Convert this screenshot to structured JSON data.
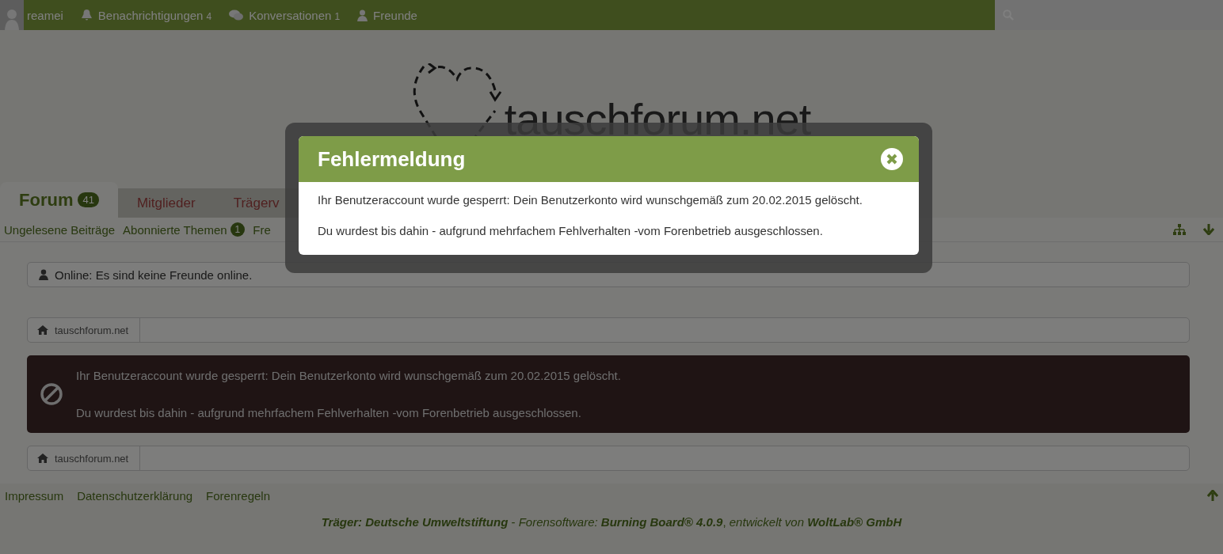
{
  "user_bar": {
    "username": "reamei",
    "items": [
      {
        "kind": "notifications",
        "label": "Benachrichtigungen",
        "count": "4"
      },
      {
        "kind": "conversations",
        "label": "Konversationen",
        "count": "1"
      },
      {
        "kind": "friends",
        "label": "Freunde"
      }
    ]
  },
  "logo": {
    "text": "tauschforum.net"
  },
  "tabs": [
    {
      "label": "Forum",
      "badge": "41",
      "selected": true
    },
    {
      "label": "Mitglieder",
      "selected": false
    },
    {
      "label": "Trägerv",
      "selected": false
    }
  ],
  "subnav": [
    {
      "label": "Ungelesene Beiträge"
    },
    {
      "label": "Abonnierte Themen",
      "badge": "1"
    },
    {
      "label": "Fre"
    }
  ],
  "online_box": {
    "text": "Online: Es sind keine Freunde online."
  },
  "breadcrumbs_top": [
    "tauschforum.net"
  ],
  "error_box": {
    "lines": [
      "Ihr Benutzeraccount wurde gesperrt: Dein Benutzerkonto wird wunschgemäß zum 20.02.2015 gelöscht.",
      "Du wurdest bis dahin - aufgrund mehrfachem Fehlverhalten -vom Forenbetrieb ausgeschlossen."
    ]
  },
  "breadcrumbs_bottom": [
    "tauschforum.net"
  ],
  "footer_links": [
    "Impressum",
    "Datenschutzerklärung",
    "Forenregeln"
  ],
  "copyright": "**Träger: Deutsche Umweltstiftung** - *Forensoftware:* **Burning Board® 4.0.9**, *entwickelt von* **WoltLab® GmbH**",
  "dialog": {
    "title": "Fehlermeldung",
    "lines": [
      "Ihr Benutzeraccount wurde gesperrt: Dein Benutzerkonto wird wunschgemäß zum 20.02.2015 gelöscht.",
      "Du wurdest bis dahin - aufgrund mehrfachem Fehlverhalten -vom Forenbetrieb ausgeschlossen."
    ]
  }
}
